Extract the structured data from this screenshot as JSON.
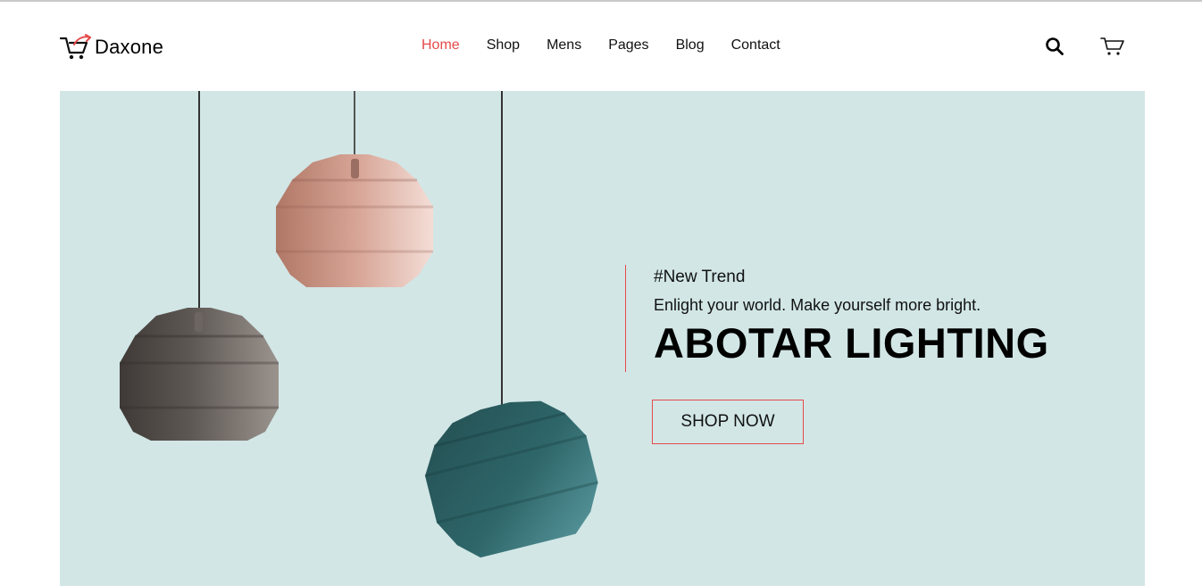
{
  "brand": {
    "name": "Daxone",
    "accent": "#e64a4a"
  },
  "nav": {
    "items": [
      {
        "label": "Home",
        "active": true
      },
      {
        "label": "Shop"
      },
      {
        "label": "Mens"
      },
      {
        "label": "Pages"
      },
      {
        "label": "Blog"
      },
      {
        "label": "Contact"
      }
    ]
  },
  "header_icons": {
    "search": "search-icon",
    "cart": "cart-icon"
  },
  "hero": {
    "tag": "#New Trend",
    "subtitle": "Enlight your world. Make yourself more bright.",
    "title": "ABOTAR LIGHTING",
    "button_label": "SHOP NOW",
    "background": "#d2e6e6"
  }
}
